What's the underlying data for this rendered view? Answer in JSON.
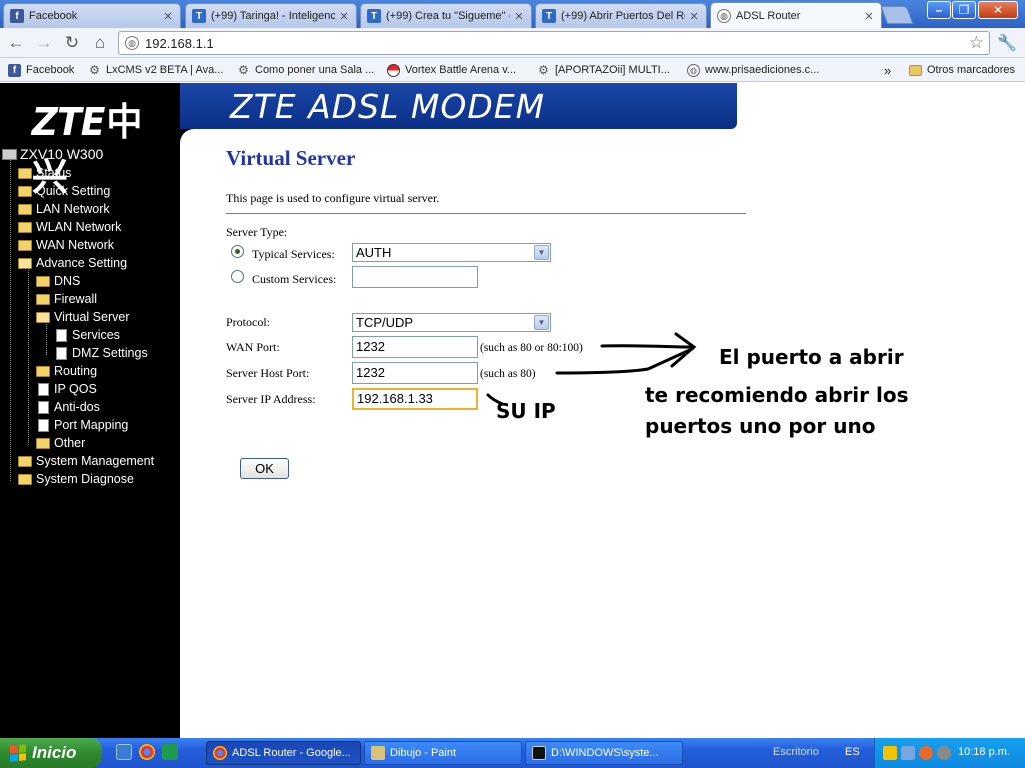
{
  "browser": {
    "tabs": [
      {
        "label": "Facebook",
        "icon": "facebook-icon"
      },
      {
        "label": "(+99) Taringa! - Inteligenc",
        "icon": "taringa-icon"
      },
      {
        "label": "(+99) Crea tu \"Sigueme\" -",
        "icon": "taringa-icon"
      },
      {
        "label": "(+99) Abrir Puertos Del Ro",
        "icon": "taringa-icon"
      },
      {
        "label": "ADSL Router",
        "icon": "globe-icon"
      }
    ],
    "address": "192.168.1.1",
    "bookmarks": [
      {
        "label": "Facebook"
      },
      {
        "label": "LxCMS v2 BETA | Ava..."
      },
      {
        "label": "Como poner una Sala ..."
      },
      {
        "label": "Vortex Battle Arena v..."
      },
      {
        "label": "[APORTAZOii] MULTI..."
      },
      {
        "label": "www.prisaediciones.c..."
      }
    ],
    "overflow_chevron": "»",
    "other_bookmarks": "Otros marcadores"
  },
  "router": {
    "logo_latin": "ZTE",
    "logo_cn": "中兴",
    "banner_title": "ZTE ADSL MODEM",
    "tree": {
      "root": "ZXV10 W300",
      "items": [
        "Status",
        "Quick Setting",
        "LAN Network",
        "WLAN Network",
        "WAN Network",
        "Advance Setting",
        "DNS",
        "Firewall",
        "Virtual Server",
        "Services",
        "DMZ Settings",
        "Routing",
        "IP QOS",
        "Anti-dos",
        "Port Mapping",
        "Other",
        "System Management",
        "System Diagnose"
      ]
    },
    "form": {
      "title": "Virtual Server",
      "description": "This page is used to configure virtual server.",
      "server_type_label": "Server Type:",
      "typical_label": "Typical Services:",
      "typical_value": "AUTH",
      "custom_label": "Custom Services:",
      "custom_value": "",
      "protocol_label": "Protocol:",
      "protocol_value": "TCP/UDP",
      "wan_port_label": "WAN Port:",
      "wan_port_value": "1232",
      "wan_port_hint": "(such as 80 or 80:100)",
      "host_port_label": "Server Host Port:",
      "host_port_value": "1232",
      "host_port_hint": "(such as 80)",
      "ip_label": "Server IP Address:",
      "ip_value": "192.168.1.33",
      "ok_label": "OK"
    }
  },
  "annotations": {
    "port_note": "El puerto a abrir",
    "recommend_line1": "te recomiendo abrir los",
    "recommend_line2": "puertos uno por uno",
    "ip_note": "SU IP"
  },
  "taskbar": {
    "start_label": "Inicio",
    "tasks": [
      {
        "label": "ADSL Router - Google..."
      },
      {
        "label": "Dibujo - Paint"
      },
      {
        "label": "D:\\WINDOWS\\syste..."
      }
    ],
    "desktop_label": "Escritorio",
    "language": "ES",
    "clock": "10:18 p.m."
  },
  "colors": {
    "banner_blue": "#0a2f86",
    "title_blue": "#2434a8",
    "xp_taskbar": "#245edb",
    "start_green": "#2f8a2f"
  }
}
